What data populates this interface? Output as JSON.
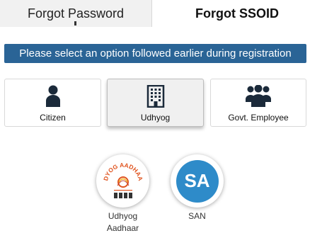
{
  "tabs": [
    {
      "label": "Forgot Password",
      "active": false
    },
    {
      "label": "Forgot SSOID",
      "active": true
    }
  ],
  "banner": {
    "text": "Please select an option followed earlier during registration",
    "color": "#2a6496"
  },
  "options": [
    {
      "label": "Citizen",
      "icon": "person-icon",
      "selected": false
    },
    {
      "label": "Udhyog",
      "icon": "building-icon",
      "selected": true
    },
    {
      "label": "Govt. Employee",
      "icon": "group-icon",
      "selected": false
    }
  ],
  "sub_options": [
    {
      "label_line1": "Udhyog",
      "label_line2": "Aadhaar",
      "icon": "udhyog-aadhaar-logo",
      "logo_text": "UDYOG AADHAAR"
    },
    {
      "label": "SAN",
      "icon": "san-logo",
      "logo_text": "SA",
      "color": "#2e8bc9"
    }
  ]
}
